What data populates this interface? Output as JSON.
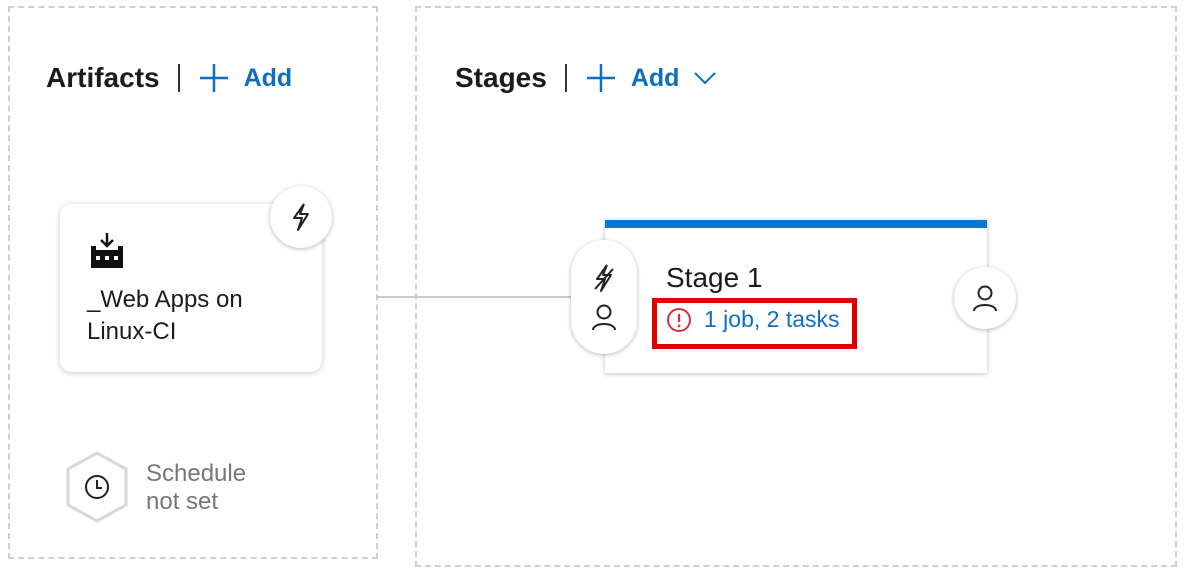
{
  "artifacts": {
    "title": "Artifacts",
    "add_label": "Add",
    "card": {
      "name_line1": "_Web Apps on",
      "name_line2": "Linux-CI",
      "icon": "build-artifact-icon",
      "trigger_icon": "lightning-icon"
    },
    "schedule": {
      "line1": "Schedule",
      "line2": "not set",
      "icon": "clock-icon"
    }
  },
  "stages": {
    "title": "Stages",
    "add_label": "Add",
    "stage": {
      "name": "Stage 1",
      "tasks_label": "1 job, 2 tasks",
      "warning_icon": "error-circle-icon",
      "pre_deployment_icons": [
        "lightning-icon",
        "person-icon"
      ],
      "post_deployment_icon": "person-icon"
    }
  },
  "colors": {
    "accent": "#0078d4",
    "link": "#106ebe",
    "error": "#d13438",
    "highlight": "#e00000"
  }
}
